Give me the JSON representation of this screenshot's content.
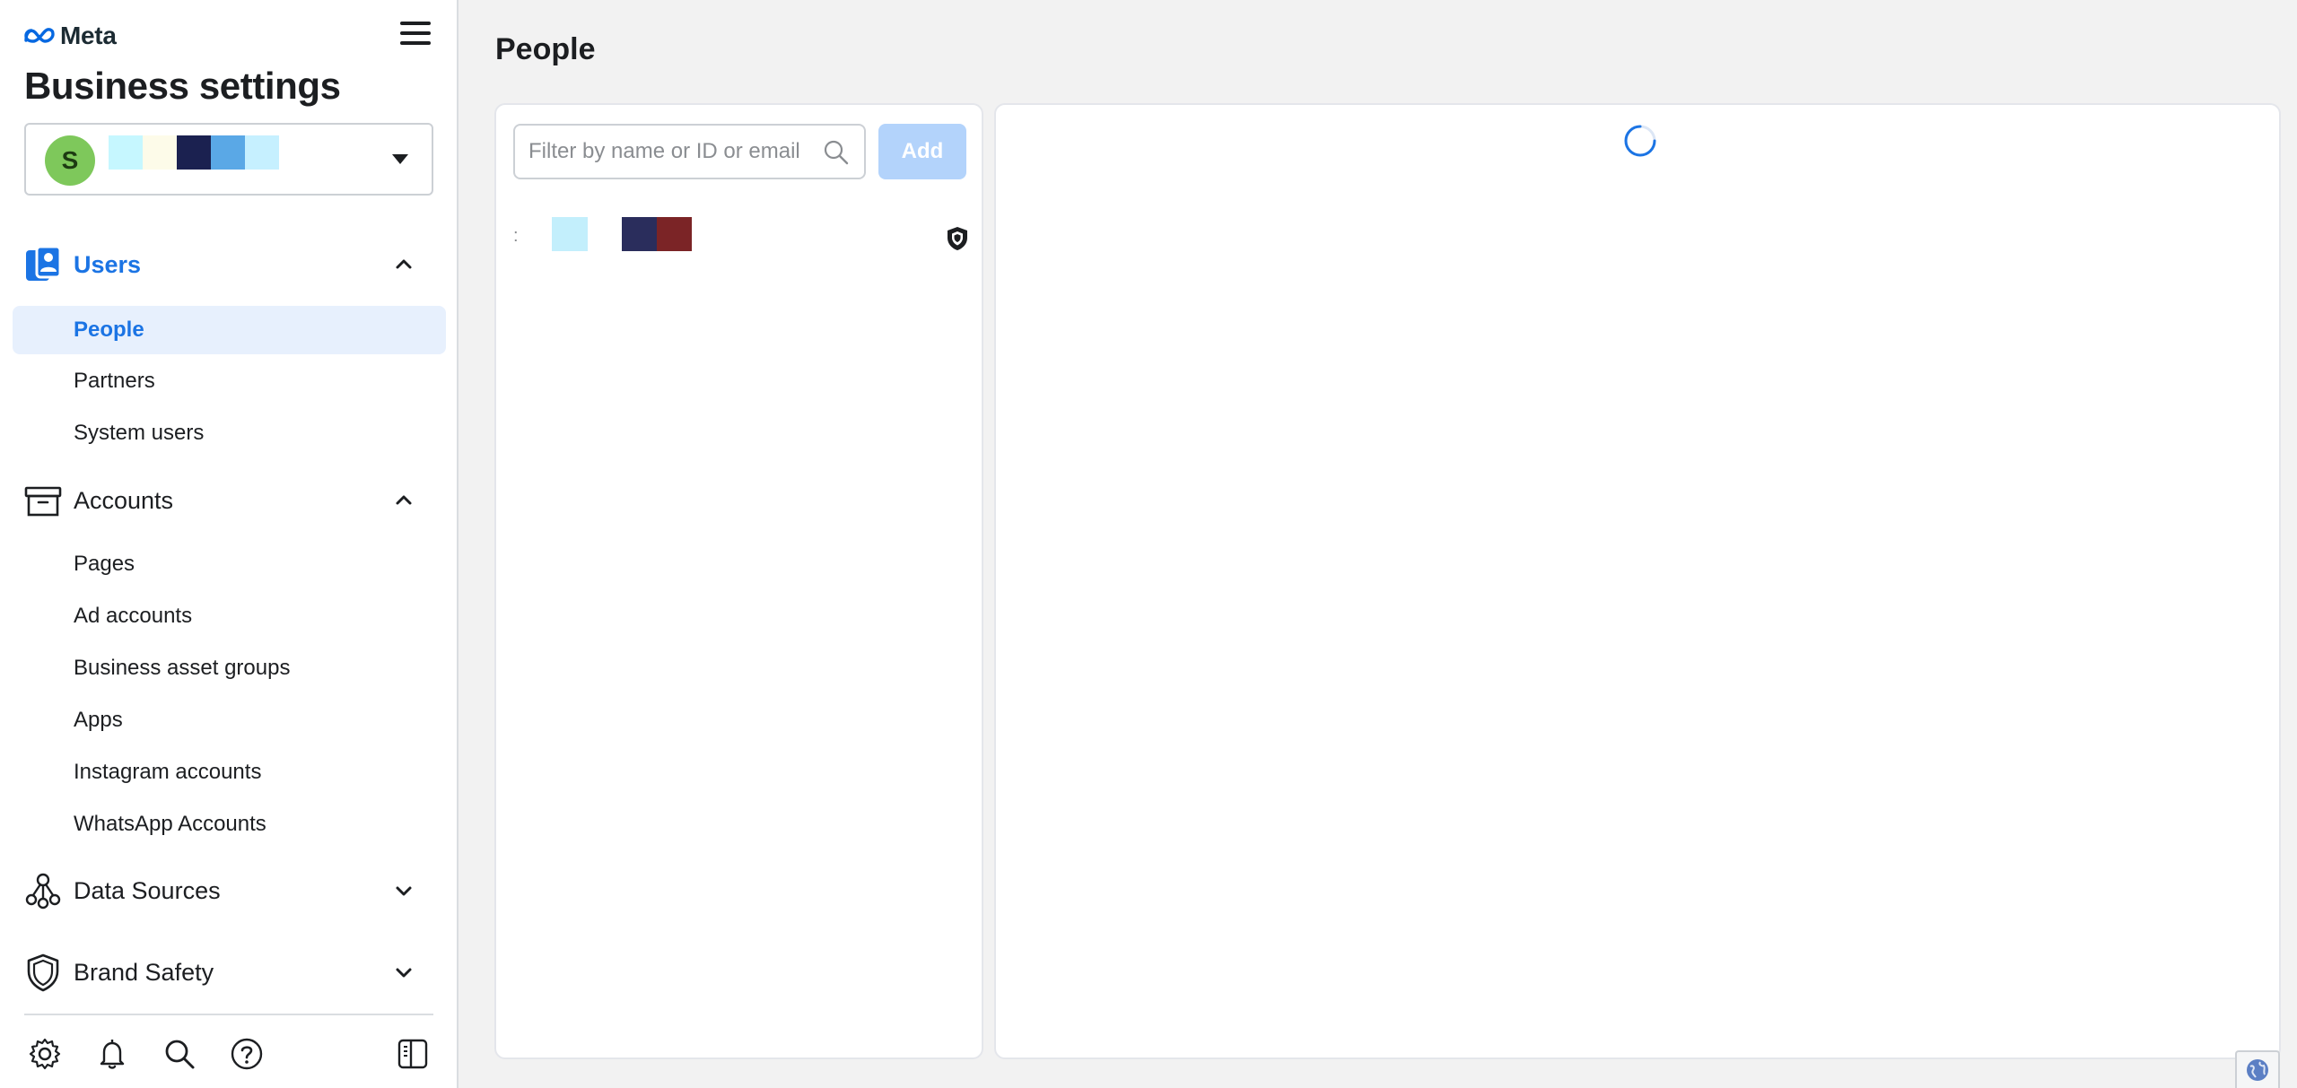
{
  "app": {
    "logo_text": "Meta",
    "title": "Business settings"
  },
  "account": {
    "avatar_initial": "S",
    "redaction_colors": [
      "#c6f7ff",
      "#fdfbe9",
      "#1b2150",
      "#5aa8e6",
      "#c6f0ff"
    ]
  },
  "sidebar": {
    "sections": [
      {
        "label": "Users",
        "icon": "users-icon",
        "expanded": true,
        "active": true,
        "items": [
          "People",
          "Partners",
          "System users"
        ]
      },
      {
        "label": "Accounts",
        "icon": "archive-box-icon",
        "expanded": true,
        "active": false,
        "items": [
          "Pages",
          "Ad accounts",
          "Business asset groups",
          "Apps",
          "Instagram accounts",
          "WhatsApp Accounts"
        ]
      },
      {
        "label": "Data Sources",
        "icon": "data-sources-icon",
        "expanded": false,
        "active": false,
        "items": []
      },
      {
        "label": "Brand Safety",
        "icon": "shield-icon",
        "expanded": false,
        "active": false,
        "items": []
      }
    ],
    "selected_item": "People",
    "bottom_icons": [
      "gear-icon",
      "bell-icon",
      "search-icon",
      "help-icon",
      "sidebar-toggle-icon"
    ]
  },
  "main": {
    "page_title": "People",
    "search": {
      "placeholder": "Filter by name or ID or email",
      "value": ""
    },
    "add_label": "Add",
    "people": [
      {
        "dots": ":",
        "redaction_colors": [
          "#c3effc",
          "#2a2d5c",
          "#7b2426"
        ],
        "badge_icon": "admin-shield-icon"
      }
    ],
    "detail": {
      "loading": true
    }
  },
  "colors": {
    "accent": "#1b74e4",
    "selected_bg": "#e7f0fd",
    "add_button_disabled": "#b3d3fb",
    "avatar_bg": "#7ec85b"
  }
}
